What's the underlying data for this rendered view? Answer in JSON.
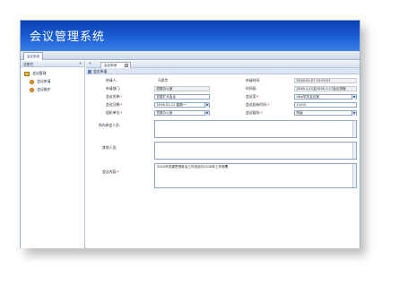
{
  "app": {
    "title": "会议管理系统",
    "main_tab": "会议系统"
  },
  "sidebar": {
    "header": "导航栏",
    "collapse_icon": "«",
    "group": "会议管理",
    "items": [
      {
        "label": "会议申请"
      },
      {
        "label": "会议维护"
      }
    ]
  },
  "content": {
    "collapse_icon": "«",
    "tab_label": "会议申请",
    "section_title": "会议申请"
  },
  "form": {
    "applicant_label": "申请人:",
    "applicant_value": "马思华",
    "apply_time_label": "申请时间:",
    "apply_time_value": "2016-01-07 15:05:21",
    "apply_dept_label": "申请部门:",
    "apply_dept_value": "党委办公室",
    "duration_label": "时间段:",
    "duration_value": "2016-1-11至2016-1-17会议排程",
    "meeting_name_label": "会议名称:",
    "meeting_name_value": "党委扩大会议",
    "room_label": "会议室:",
    "room_value": "06#机关会议室",
    "date_label": "会议日期:",
    "date_value": "2016-01-11 星期一",
    "start_time_label": "会议起始时间:",
    "start_time_value": "13:00",
    "organizer_label": "组织单位:",
    "organizer_value": "党委办公室",
    "level_label": "会议级别:",
    "level_value": "院级",
    "participants_label": "所内参会人员:",
    "others_label": "其他人员:",
    "contents_label": "会议内容:",
    "contents_value": "2015年党建思想政治工作总结与2016年工作部署",
    "required_mark": "*"
  }
}
